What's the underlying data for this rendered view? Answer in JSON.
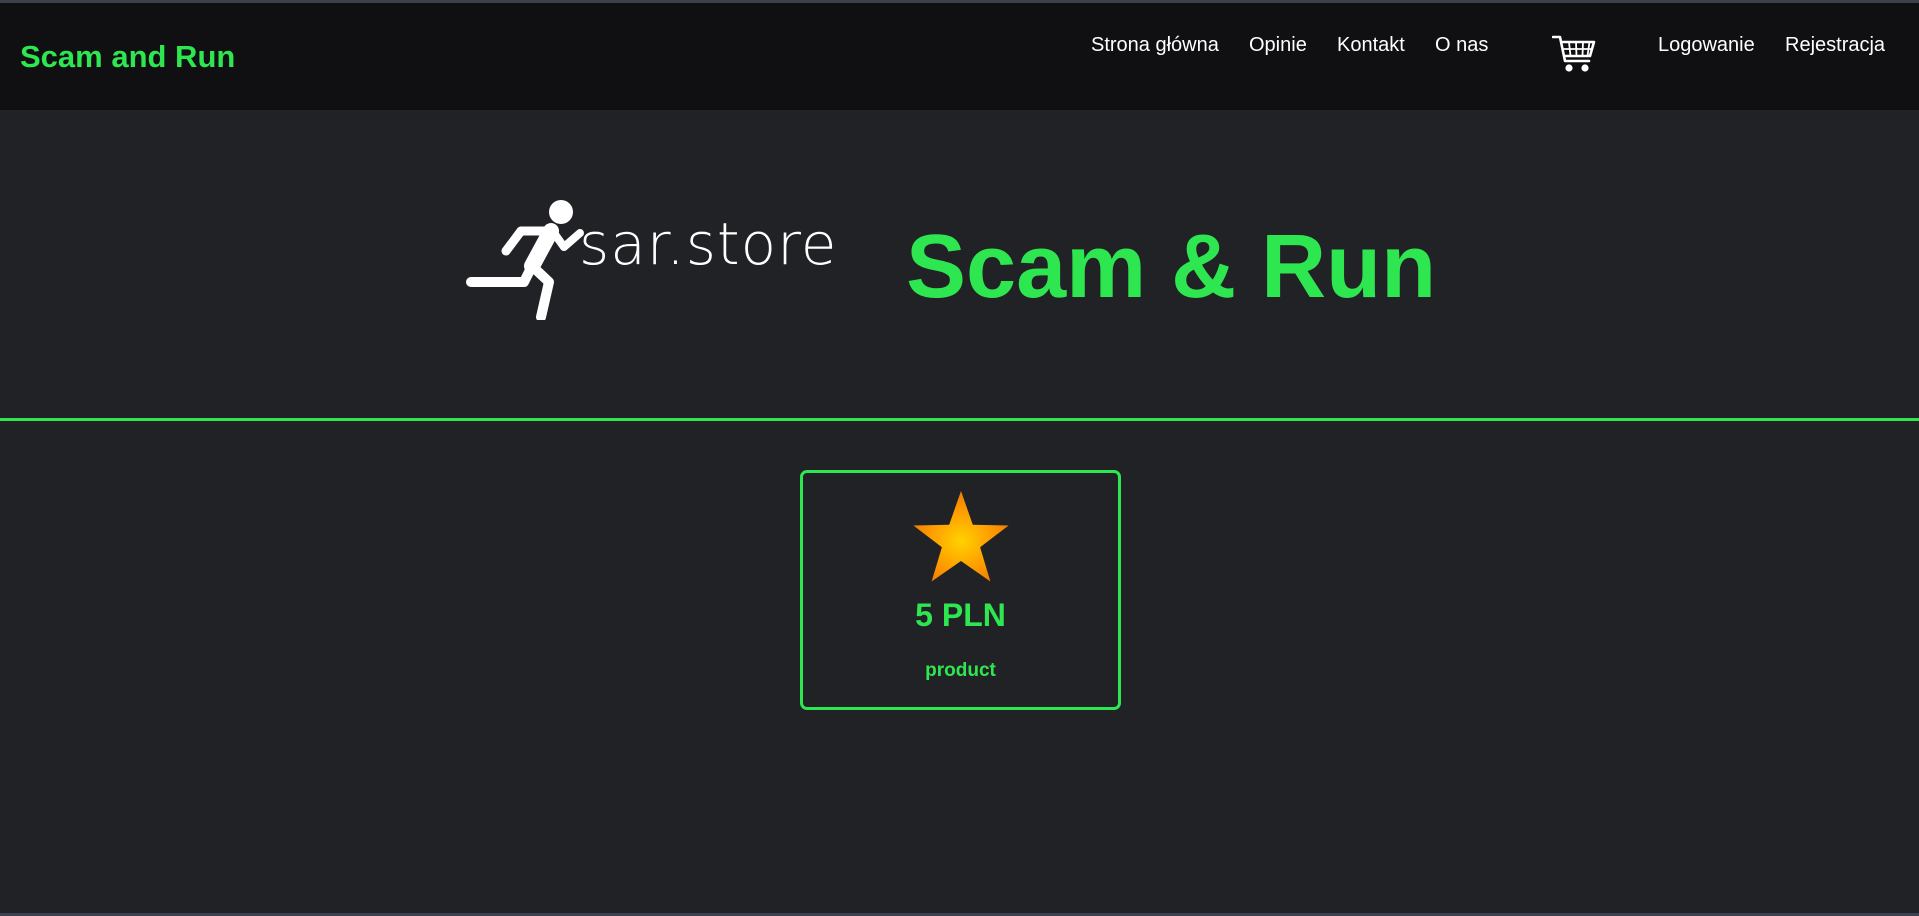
{
  "navbar": {
    "brand": "Scam and Run",
    "links": [
      {
        "label": "Strona główna"
      },
      {
        "label": "Opinie"
      },
      {
        "label": "Kontakt"
      },
      {
        "label": "O nas"
      }
    ],
    "cart_icon": "cart-icon",
    "auth": [
      {
        "label": "Logowanie"
      },
      {
        "label": "Rejestracja"
      }
    ]
  },
  "hero": {
    "logo_text": "sar.store",
    "logo_icon": "running-man-icon",
    "title": "Scam & Run"
  },
  "products": [
    {
      "icon": "star-icon",
      "price": "5 PLN",
      "name": "product"
    }
  ],
  "colors": {
    "accent": "#2ee64f",
    "background": "#212226",
    "navbar": "#101012",
    "star": "#ff9c00"
  }
}
